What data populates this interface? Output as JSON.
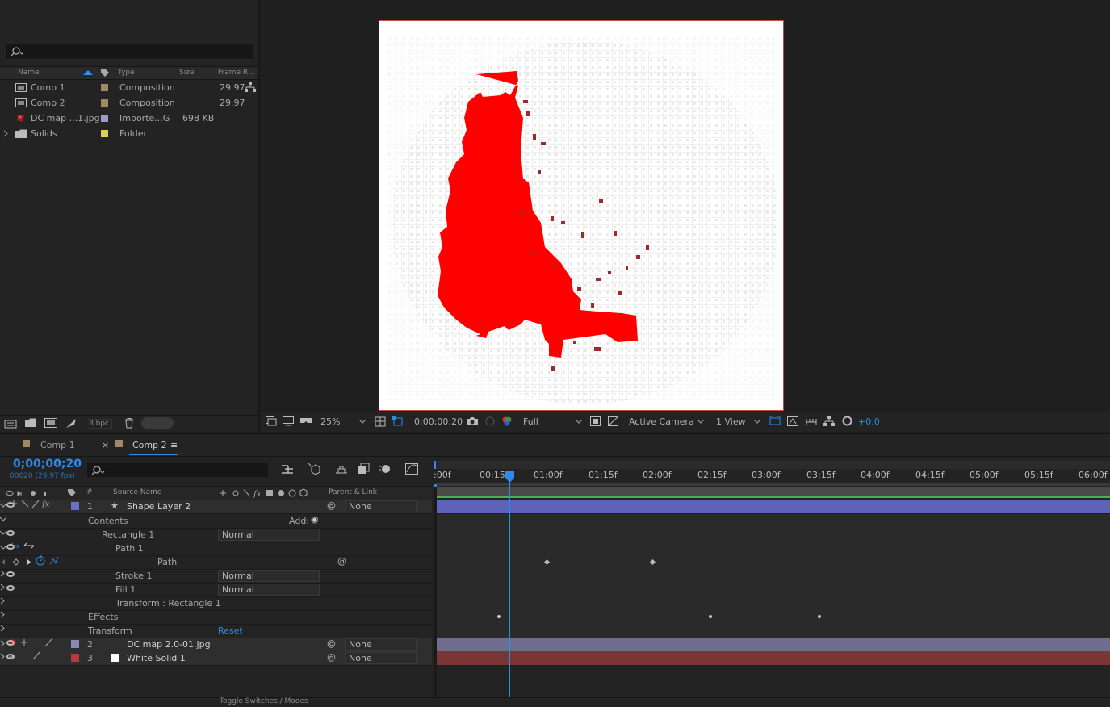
{
  "colors": {
    "accent": "#2d8ceb",
    "shape_layer": "#6a6ec8",
    "map_layer": "#8c87b4",
    "solid_layer": "#b23b3b",
    "red_shape": "#ff0000"
  },
  "project": {
    "search_placeholder": "",
    "columns": {
      "name": "Name",
      "type": "Type",
      "size": "Size",
      "frame_rate": "Frame R..."
    },
    "items": [
      {
        "name": "Comp 1",
        "type": "Composition",
        "size": "",
        "fps": "29.97",
        "swatch": "#a08866",
        "icon": "composition-icon"
      },
      {
        "name": "Comp 2",
        "type": "Composition",
        "size": "",
        "fps": "29.97",
        "swatch": "#a08866",
        "icon": "composition-icon"
      },
      {
        "name": "DC map ...1.jpg",
        "type": "Importe...G",
        "size": "698 KB",
        "fps": "",
        "swatch": "#9d9bc8",
        "icon": "image-icon"
      },
      {
        "name": "Solids",
        "type": "Folder",
        "size": "",
        "fps": "",
        "swatch": "#e0cf4a",
        "icon": "folder-icon"
      }
    ],
    "bpc": "8 bpc"
  },
  "viewer": {
    "zoom": "25%",
    "timecode": "0;00;00;20",
    "resolution": "Full",
    "camera": "Active Camera",
    "views": "1 View",
    "exposure": "+0.0"
  },
  "timeline": {
    "tabs": [
      {
        "label": "Comp 1",
        "active": false
      },
      {
        "label": "Comp 2",
        "active": true
      }
    ],
    "current_time": "0;00;00;20",
    "frame_info": "00020 (29.97 fps)",
    "columns": {
      "num": "#",
      "source": "Source Name",
      "parent": "Parent & Link"
    },
    "ruler": [
      ":00f",
      "00:15f",
      "01:00f",
      "01:15f",
      "02:00f",
      "02:15f",
      "03:00f",
      "03:15f",
      "04:00f",
      "04:15f",
      "05:00f",
      "05:15f",
      "06:00f"
    ],
    "layers": [
      {
        "num": "1",
        "name": "Shape Layer 2",
        "parent": "None"
      },
      {
        "num": "2",
        "name": "DC map 2.0-01.jpg",
        "parent": "None"
      },
      {
        "num": "3",
        "name": "White Solid 1",
        "parent": "None"
      }
    ],
    "props": {
      "contents": "Contents",
      "add": "Add:",
      "rectangle": "Rectangle 1",
      "rectangle_mode": "Normal",
      "path1": "Path 1",
      "path": "Path",
      "stroke": "Stroke 1",
      "stroke_mode": "Normal",
      "fill": "Fill 1",
      "fill_mode": "Normal",
      "transform_rect": "Transform : Rectangle 1",
      "effects": "Effects",
      "transform": "Transform",
      "reset": "Reset"
    },
    "toggle_label": "Toggle Switches / Modes"
  }
}
